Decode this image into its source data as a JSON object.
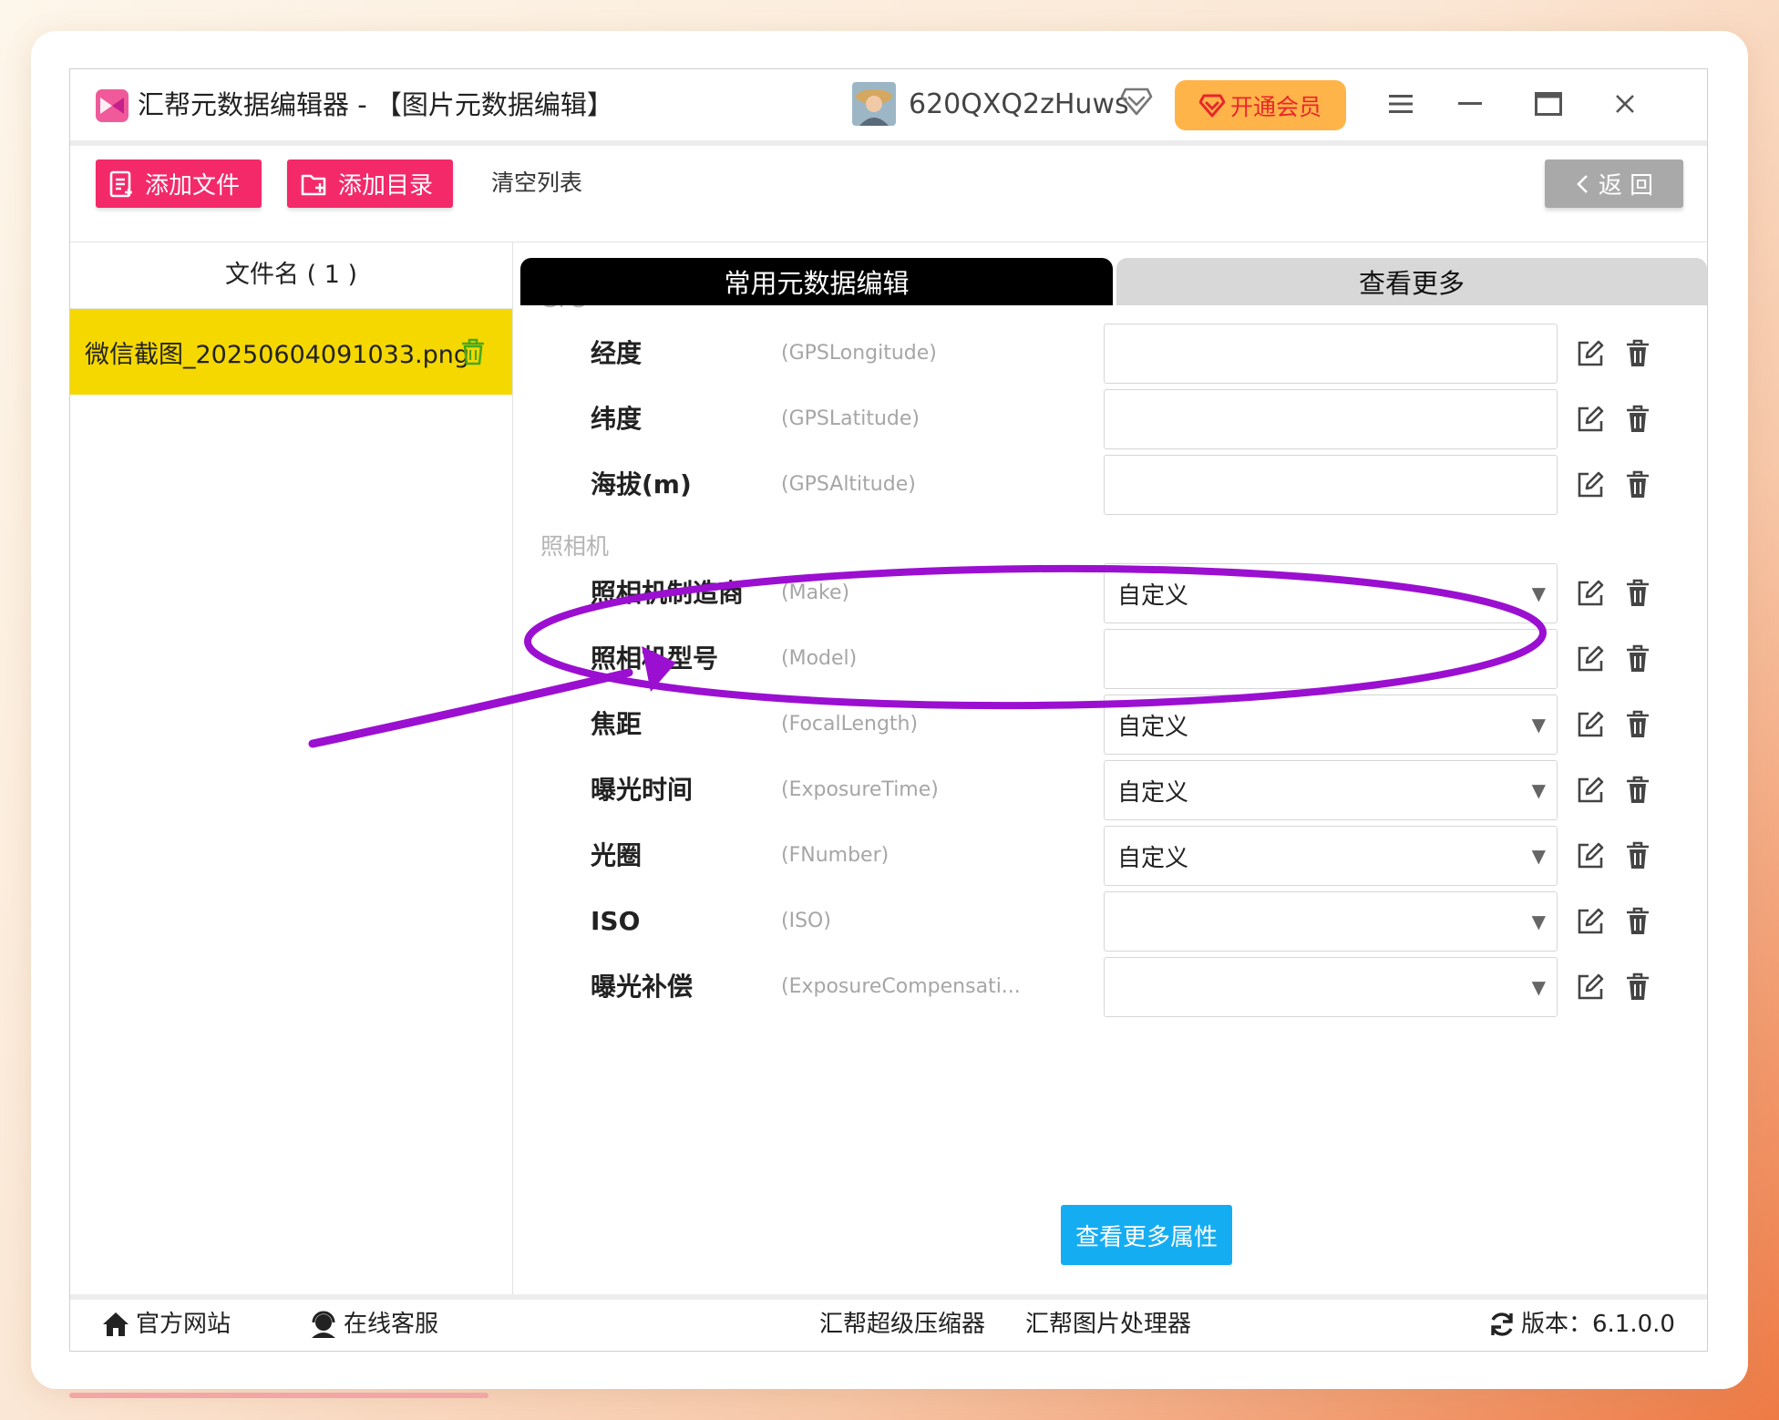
{
  "window": {
    "title": "汇帮元数据编辑器 - 【图片元数据编辑】",
    "username": "620QXQ2zHuws",
    "vip_label": "开通会员"
  },
  "toolbar": {
    "add_file": "添加文件",
    "add_dir": "添加目录",
    "clear_list": "清空列表",
    "back": "返 回"
  },
  "filelist": {
    "header": "文件名 ( 1 )",
    "files": [
      "微信截图_20250604091033.png"
    ]
  },
  "tabs": {
    "common": "常用元数据编辑",
    "more": "查看更多"
  },
  "sections": {
    "gps": "GPS",
    "camera": "照相机"
  },
  "fields": [
    {
      "label": "经度",
      "key": "(GPSLongitude)",
      "value": ""
    },
    {
      "label": "纬度",
      "key": "(GPSLatitude)",
      "value": ""
    },
    {
      "label": "海拔(m)",
      "key": "(GPSAltitude)",
      "value": ""
    },
    {
      "label": "照相机制造商",
      "key": "(Make)",
      "value": "自定义"
    },
    {
      "label": "照相机型号",
      "key": "(Model)",
      "value": ""
    },
    {
      "label": "焦距",
      "key": "(FocalLength)",
      "value": "自定义"
    },
    {
      "label": "曝光时间",
      "key": "(ExposureTime)",
      "value": "自定义"
    },
    {
      "label": "光圈",
      "key": "(FNumber)",
      "value": "自定义"
    },
    {
      "label": "ISO",
      "key": "(ISO)",
      "value": ""
    },
    {
      "label": "曝光补偿",
      "key": "(ExposureCompensati...",
      "value": ""
    }
  ],
  "more_attr_button": "查看更多属性",
  "footer": {
    "website": "官方网站",
    "support": "在线客服",
    "compressor": "汇帮超级压缩器",
    "image_processor": "汇帮图片处理器",
    "version": "版本：6.1.0.0"
  },
  "colors": {
    "accent_pink": "#f3296a",
    "file_highlight": "#f5d800",
    "vip_orange": "#ffb44a",
    "annotation_purple": "#9b0fd1",
    "primary_blue": "#15adf2"
  }
}
